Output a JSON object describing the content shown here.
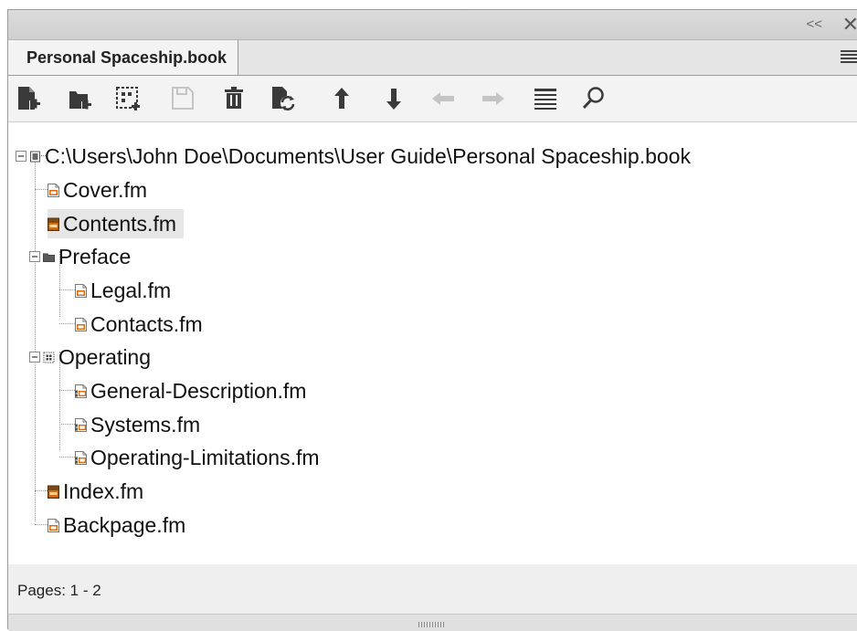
{
  "window": {
    "collapse_glyph": "<<",
    "close_glyph": "✕"
  },
  "tab": {
    "label": "Personal Spaceship.book"
  },
  "toolbar": {
    "buttons": [
      {
        "icon": "add-file-icon",
        "enabled": true
      },
      {
        "icon": "add-folder-icon",
        "enabled": true
      },
      {
        "icon": "add-group-icon",
        "enabled": true
      },
      {
        "icon": "save-icon",
        "enabled": false
      },
      {
        "icon": "trash-icon",
        "enabled": true
      },
      {
        "icon": "update-book-icon",
        "enabled": true
      },
      {
        "icon": "arrow-up-icon",
        "enabled": true
      },
      {
        "icon": "arrow-down-icon",
        "enabled": true
      },
      {
        "icon": "arrow-left-icon",
        "enabled": false
      },
      {
        "icon": "arrow-right-icon",
        "enabled": false
      },
      {
        "icon": "list-icon",
        "enabled": true
      },
      {
        "icon": "search-icon",
        "enabled": true
      }
    ]
  },
  "tree": {
    "root": "C:\\Users\\John Doe\\Documents\\User Guide\\Personal Spaceship.book",
    "items": [
      {
        "label": "Cover.fm"
      },
      {
        "label": "Contents.fm",
        "selected": true
      },
      {
        "label": "Preface"
      },
      {
        "label": "Legal.fm"
      },
      {
        "label": "Contacts.fm"
      },
      {
        "label": "Operating"
      },
      {
        "label": "General-Description.fm"
      },
      {
        "label": "Systems.fm"
      },
      {
        "label": "Operating-Limitations.fm"
      },
      {
        "label": "Index.fm"
      },
      {
        "label": "Backpage.fm"
      }
    ]
  },
  "status": {
    "text": "Pages: 1 - 2"
  },
  "colors": {
    "fm_orange": "#e06a10",
    "icon_dark": "#3a3a3a",
    "disabled": "#c4c4c4",
    "selection": "#e6e6e6"
  }
}
